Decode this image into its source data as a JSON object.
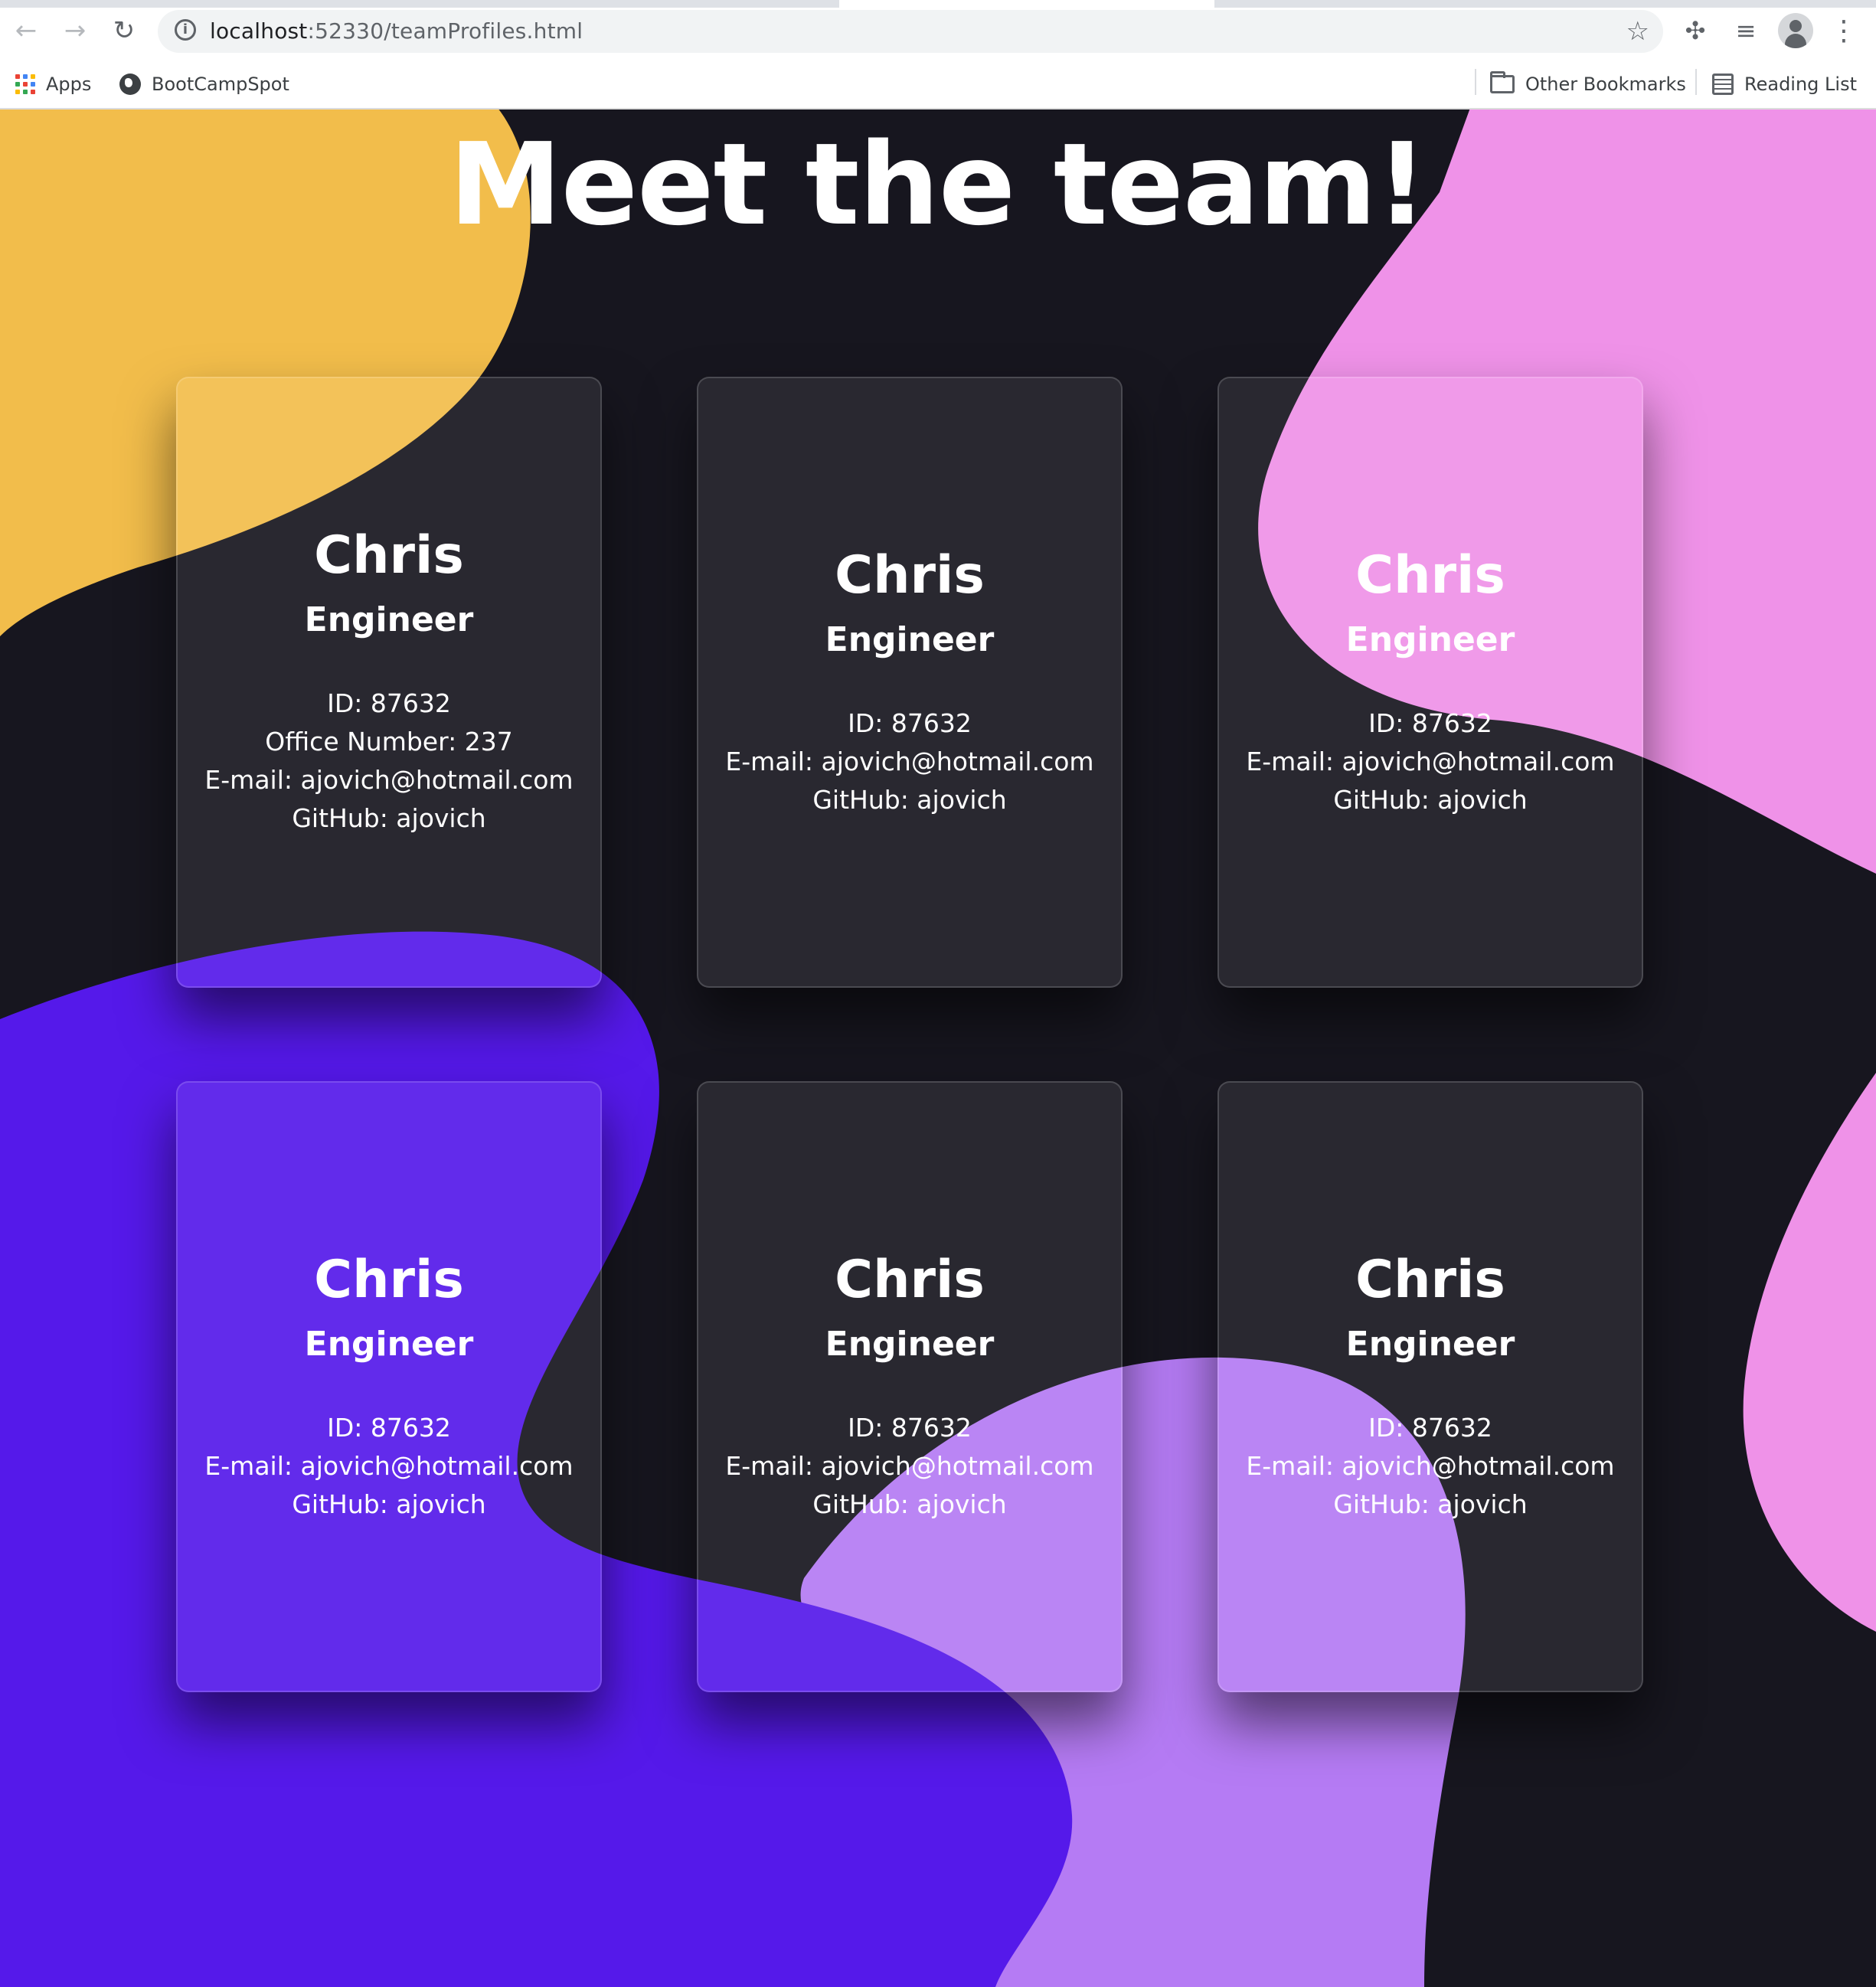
{
  "browser": {
    "url_host": "localhost",
    "url_path": ":52330/teamProfiles.html",
    "bookmarks": {
      "apps_label": "Apps",
      "bootcamp_label": "BootCampSpot",
      "other_label": "Other Bookmarks",
      "reading_label": "Reading List"
    }
  },
  "page": {
    "title": "Meet the team!",
    "colors": {
      "background": "#17161f",
      "blob_yellow": "#f2bd4b",
      "blob_pink": "#ef92e8",
      "blob_indigo": "#5519ea",
      "blob_lilac": "#b57bf4"
    }
  },
  "cards": [
    {
      "name": "Chris",
      "role": "Engineer",
      "id": "ID: 87632",
      "office": "Office Number: 237",
      "email": "E-mail: ajovich@hotmail.com",
      "github": "GitHub: ajovich"
    },
    {
      "name": "Chris",
      "role": "Engineer",
      "id": "ID: 87632",
      "email": "E-mail: ajovich@hotmail.com",
      "github": "GitHub: ajovich"
    },
    {
      "name": "Chris",
      "role": "Engineer",
      "id": "ID: 87632",
      "email": "E-mail: ajovich@hotmail.com",
      "github": "GitHub: ajovich"
    },
    {
      "name": "Chris",
      "role": "Engineer",
      "id": "ID: 87632",
      "email": "E-mail: ajovich@hotmail.com",
      "github": "GitHub: ajovich"
    },
    {
      "name": "Chris",
      "role": "Engineer",
      "id": "ID: 87632",
      "email": "E-mail: ajovich@hotmail.com",
      "github": "GitHub: ajovich"
    },
    {
      "name": "Chris",
      "role": "Engineer",
      "id": "ID: 87632",
      "email": "E-mail: ajovich@hotmail.com",
      "github": "GitHub: ajovich"
    }
  ]
}
